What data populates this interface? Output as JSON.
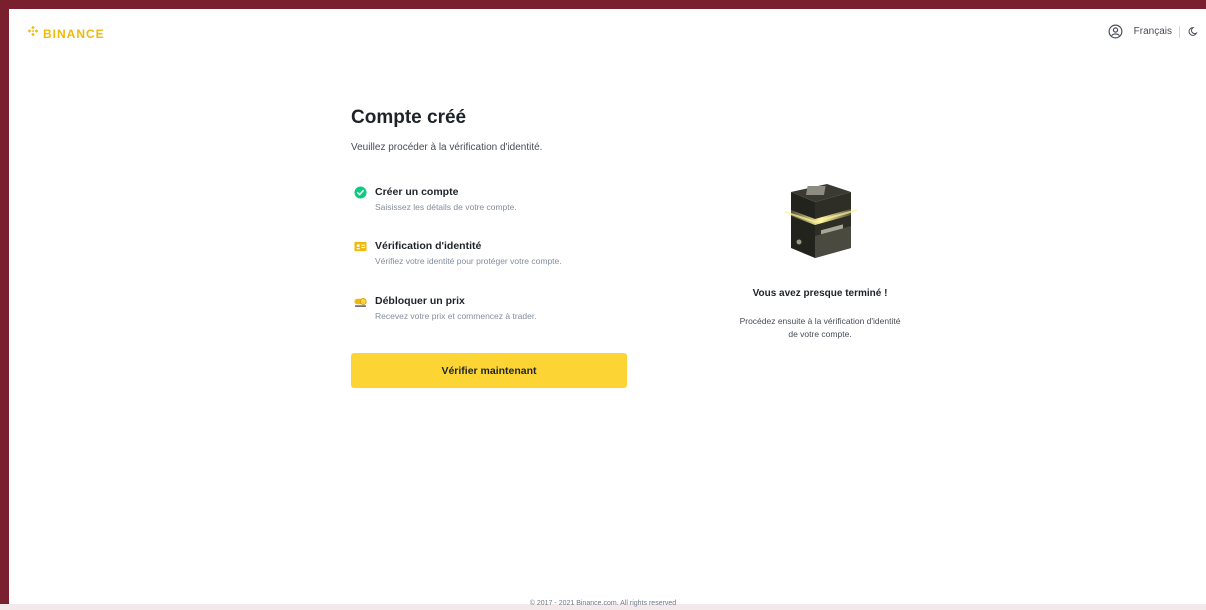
{
  "header": {
    "logo_text": "BINANCE",
    "language": "Français",
    "icons": [
      "user-icon",
      "moon-icon"
    ]
  },
  "main": {
    "title": "Compte créé",
    "subtitle": "Veuillez procéder à la vérification d'identité.",
    "steps": [
      {
        "title": "Créer un compte",
        "description": "Saisissez les détails de votre compte.",
        "icon": "check-circle-icon",
        "status": "done"
      },
      {
        "title": "Vérification d'identité",
        "description": "Vérifiez votre identité pour protéger votre compte.",
        "icon": "id-card-icon"
      },
      {
        "title": "Débloquer un prix",
        "description": "Recevez votre prix et commencez à trader.",
        "icon": "reward-icon"
      }
    ],
    "cta_label": "Vérifier maintenant"
  },
  "aside": {
    "title": "Vous avez presque terminé !",
    "description_line1": "Procédez ensuite à la vérification d'identité",
    "description_line2": "de votre compte."
  },
  "footer": {
    "copyright": "© 2017 - 2021 Binance.com. All rights reserved"
  },
  "colors": {
    "brand": "#f0b90b",
    "button": "#fcd535",
    "success": "#0ecb81",
    "frame": "#7a1f2e"
  }
}
